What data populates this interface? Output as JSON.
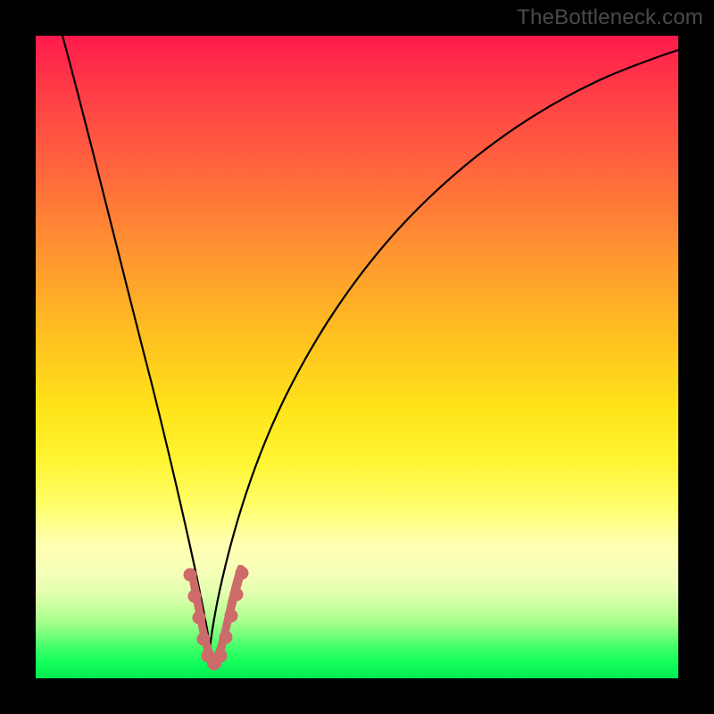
{
  "watermark": "TheBottleneck.com",
  "colors": {
    "frame": "#000000",
    "curve": "#000000",
    "marker": "#cd6a6a",
    "gradient_top": "#ff1a4d",
    "gradient_bottom": "#00ea52"
  },
  "chart_data": {
    "type": "line",
    "title": "",
    "xlabel": "",
    "ylabel": "",
    "xlim": [
      0,
      100
    ],
    "ylim": [
      0,
      100
    ],
    "grid": false,
    "x": [
      0,
      2,
      4,
      6,
      8,
      10,
      12,
      14,
      16,
      18,
      20,
      22,
      24,
      26,
      27,
      28,
      30,
      32,
      34,
      36,
      38,
      40,
      44,
      48,
      52,
      56,
      60,
      64,
      68,
      72,
      76,
      80,
      84,
      88,
      92,
      96,
      100
    ],
    "values": [
      100,
      94,
      88,
      82,
      76,
      70,
      64,
      57,
      50,
      43,
      35,
      26,
      17,
      7,
      2,
      7,
      17,
      26,
      34,
      41,
      47,
      52,
      60,
      66,
      71,
      75,
      78.5,
      81.5,
      84,
      86,
      87.8,
      89.2,
      90.4,
      91.4,
      92.2,
      92.8,
      93.3
    ],
    "markers": {
      "x": [
        23.5,
        24,
        24.5,
        25,
        25.5,
        26,
        26.5,
        27,
        27.5,
        28,
        28.5,
        29,
        29.5,
        30,
        30.5
      ],
      "values": [
        12,
        10,
        7,
        5,
        3.5,
        2.5,
        2,
        2,
        2.5,
        3.5,
        5,
        7,
        10,
        12,
        14
      ]
    },
    "background": "vertical-gradient-red-to-green"
  }
}
